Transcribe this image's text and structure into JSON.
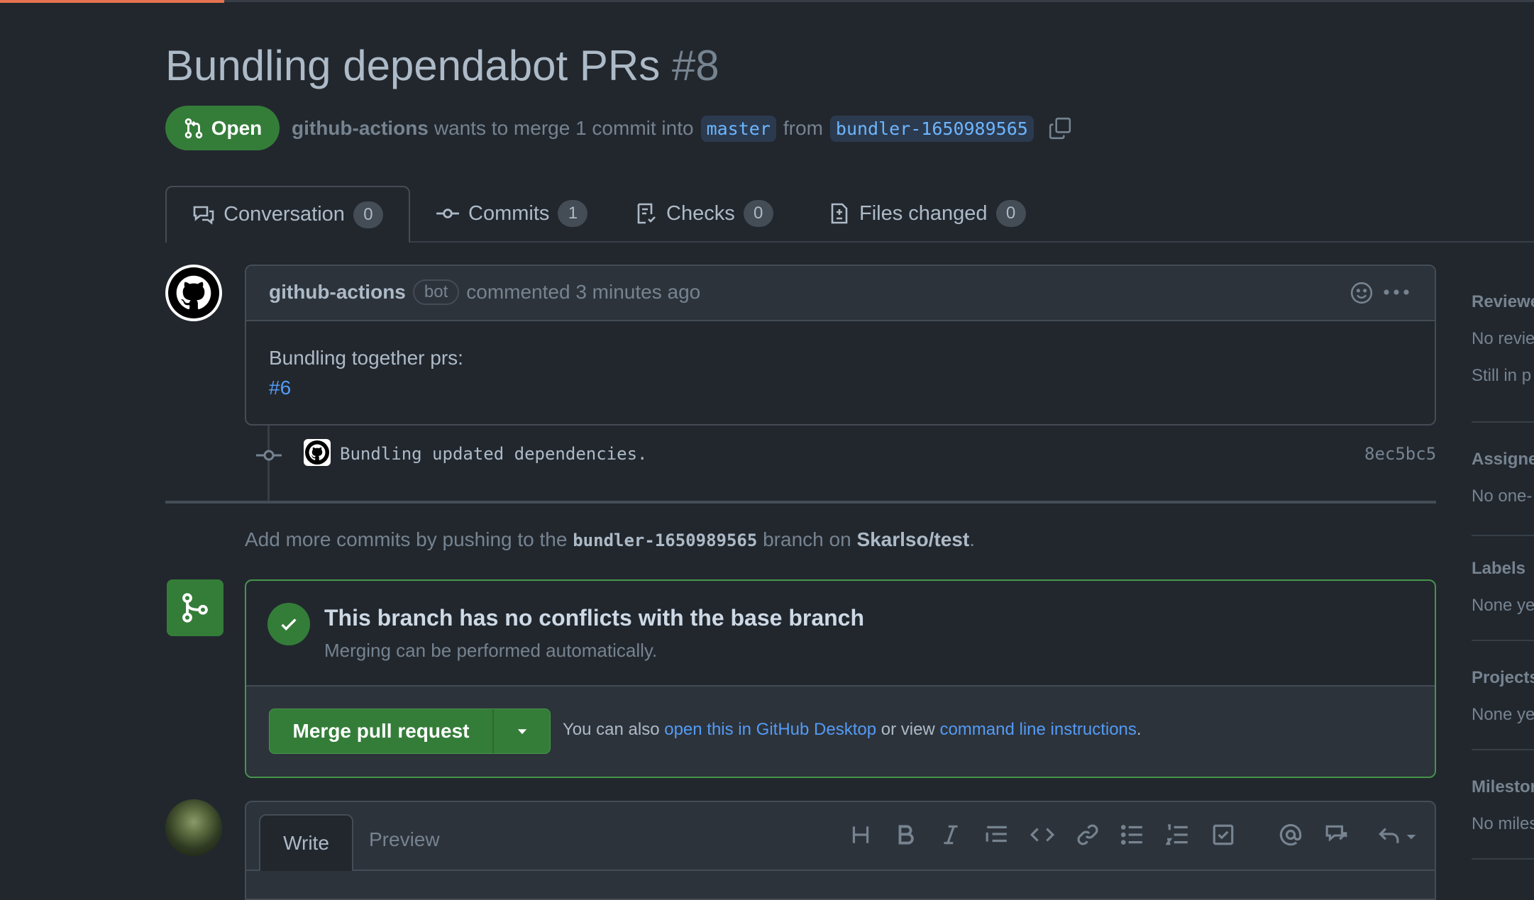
{
  "pr": {
    "title": "Bundling dependabot PRs",
    "number": "#8",
    "state": "Open",
    "author": "github-actions",
    "merge_text": "wants to merge 1 commit into",
    "base_branch": "master",
    "from_text": "from",
    "head_branch": "bundler-1650989565"
  },
  "tabs": [
    {
      "label": "Conversation",
      "count": "0"
    },
    {
      "label": "Commits",
      "count": "1"
    },
    {
      "label": "Checks",
      "count": "0"
    },
    {
      "label": "Files changed",
      "count": "0"
    }
  ],
  "comment": {
    "author": "github-actions",
    "badge": "bot",
    "action": "commented 3 minutes ago",
    "body_line1": "Bundling together prs:",
    "body_link": "#6"
  },
  "commit": {
    "message": "Bundling updated dependencies.",
    "sha": "8ec5bc5"
  },
  "push_hint": {
    "prefix": "Add more commits by pushing to the",
    "branch": "bundler-1650989565",
    "middle": "branch on",
    "repo": "Skarlso/test",
    "suffix": "."
  },
  "merge": {
    "title": "This branch has no conflicts with the base branch",
    "subtitle": "Merging can be performed automatically.",
    "button_label": "Merge pull request",
    "alt_prefix": "You can also",
    "alt_link1": "open this in GitHub Desktop",
    "alt_middle": "or view",
    "alt_link2": "command line instructions",
    "alt_suffix": "."
  },
  "editor": {
    "tab_write": "Write",
    "tab_preview": "Preview",
    "toolbar": [
      "heading-icon",
      "bold-icon",
      "italic-icon",
      "quote-icon",
      "code-icon",
      "link-icon",
      "bullet-list-icon",
      "numbered-list-icon",
      "task-list-icon",
      "mention-icon",
      "reference-icon",
      "reply-icon"
    ]
  },
  "sidebar": {
    "reviewers_title": "Reviewe",
    "reviewers_text1": "No revie",
    "reviewers_text2": "Still in p",
    "assignees_title": "Assigne",
    "assignees_text": "No one-",
    "labels_title": "Labels",
    "labels_text": "None ye",
    "projects_title": "Projects",
    "projects_text": "None ye",
    "milestone_title": "Milestor",
    "milestone_text": "No miles"
  },
  "colors": {
    "background": "#22272e",
    "accent_green": "#347d39",
    "link_blue": "#539bf5",
    "progress_orange": "#e5734f"
  }
}
